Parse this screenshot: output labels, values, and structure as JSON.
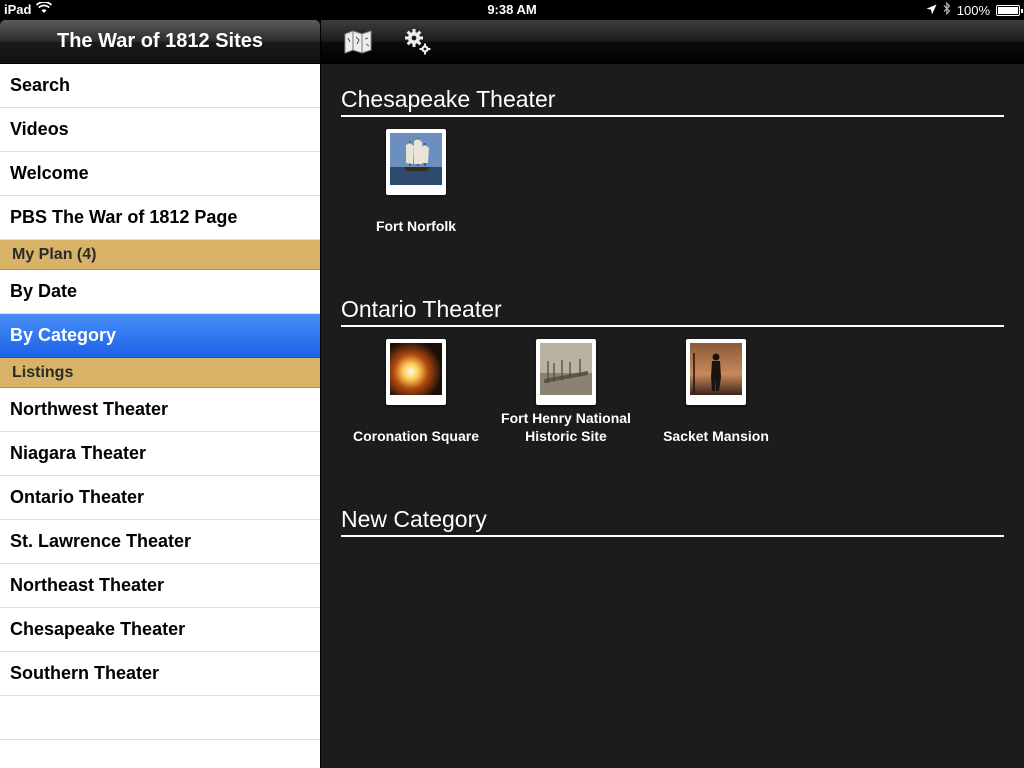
{
  "status_bar": {
    "device": "iPad",
    "time": "9:38 AM",
    "battery": "100%",
    "battery_level": 1.0,
    "icons": [
      "wifi-icon",
      "location-arrow-icon",
      "bluetooth-icon",
      "battery-icon"
    ]
  },
  "master": {
    "title": "The War of 1812 Sites",
    "top_items": [
      "Search",
      "Videos",
      "Welcome",
      "PBS The War of 1812 Page"
    ],
    "my_plan_header": "My Plan (4)",
    "plan_items": [
      "By Date",
      "By Category"
    ],
    "selected_item": "By Category",
    "listings_header": "Listings",
    "listing_items": [
      "Northwest Theater",
      "Niagara Theater",
      "Ontario Theater",
      "St. Lawrence Theater",
      "Northeast Theater",
      "Chesapeake Theater",
      "Southern Theater"
    ]
  },
  "toolbar": {
    "icons": [
      "map-icon",
      "settings-gears-icon"
    ]
  },
  "categories": [
    {
      "title": "Chesapeake Theater",
      "items": [
        {
          "label": "Fort Norfolk",
          "thumb": "tall-ship-photo"
        }
      ]
    },
    {
      "title": "Ontario Theater",
      "items": [
        {
          "label": "Coronation Square",
          "thumb": "explosion-photo"
        },
        {
          "label": "Fort Henry National Historic Site",
          "thumb": "fort-photo"
        },
        {
          "label": "Sacket Mansion",
          "thumb": "soldier-silhouette-photo"
        }
      ]
    },
    {
      "title": "New Category",
      "items": []
    }
  ],
  "colors": {
    "selected": "#1a62e8",
    "section_header": "#d8b266",
    "detail_background": "#1c1c1c"
  }
}
